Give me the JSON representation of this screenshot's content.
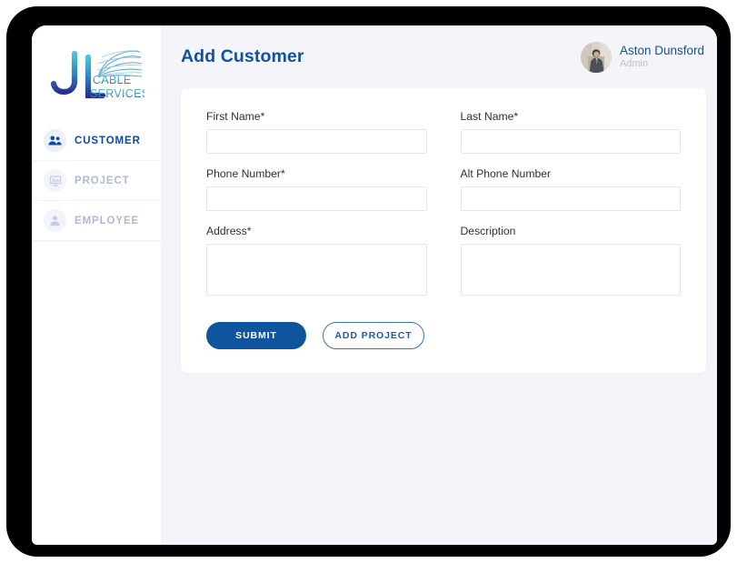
{
  "sidebar": {
    "logo": {
      "mark": "JL",
      "line1": "CABLE",
      "line2": "SERVICES",
      "icon": "fiber-fan-icon"
    },
    "items": [
      {
        "label": "CUSTOMER",
        "icon": "people-group-icon",
        "active": true
      },
      {
        "label": "PROJECT",
        "icon": "presentation-board-icon",
        "active": false
      },
      {
        "label": "EMPLOYEE",
        "icon": "person-icon",
        "active": false
      }
    ]
  },
  "topbar": {
    "title": "Add Customer",
    "user": {
      "name": "Aston Dunsford",
      "role": "Admin",
      "avatar_icon": "user-photo-avatar"
    }
  },
  "form": {
    "fields": [
      {
        "label": "First Name*",
        "value": "",
        "placeholder": "",
        "type": "input",
        "name": "first-name"
      },
      {
        "label": "Last Name*",
        "value": "",
        "placeholder": "",
        "type": "input",
        "name": "last-name"
      },
      {
        "label": "Phone Number*",
        "value": "",
        "placeholder": "",
        "type": "input",
        "name": "phone-number"
      },
      {
        "label": "Alt Phone Number",
        "value": "",
        "placeholder": "",
        "type": "input",
        "name": "alt-phone-number"
      },
      {
        "label": "Address*",
        "value": "",
        "placeholder": "",
        "type": "textarea",
        "name": "address"
      },
      {
        "label": "Description",
        "value": "",
        "placeholder": "",
        "type": "textarea",
        "name": "description"
      }
    ],
    "buttons": {
      "submit": "SUBMIT",
      "add_project": "ADD PROJECT"
    }
  },
  "colors": {
    "accent_blue": "#11549e",
    "title_blue": "#0f52a0",
    "outline_blue": "#3a72b5",
    "sidebar_active": "#0d4a9e",
    "sidebar_inactive": "#aebad2",
    "page_background": "#f4f5fa",
    "card_background": "#ffffff",
    "bezel": "#000000"
  }
}
